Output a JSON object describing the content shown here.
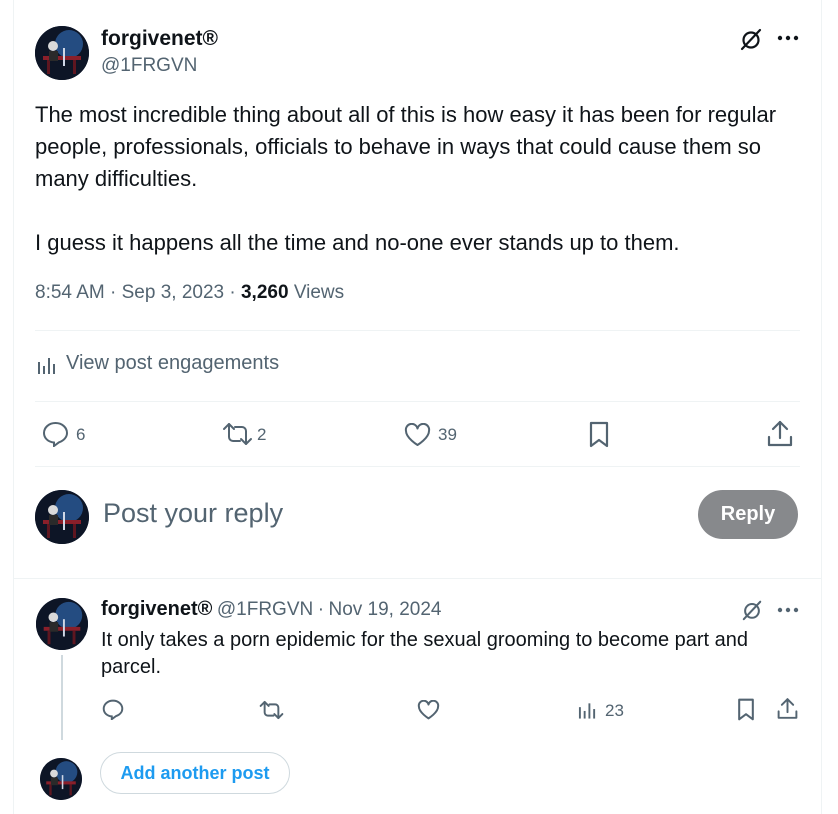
{
  "main_post": {
    "display_name": "forgivenet®",
    "handle": "@1FRGVN",
    "paragraph_1": "The most incredible thing about all of this is how easy it has been for regular people, professionals, officials to behave in ways that could cause them so many difficulties.",
    "paragraph_2": "I guess it happens all the time and no-one ever stands up to them.",
    "time": "8:54 AM",
    "dot": "·",
    "date": "Sep 3, 2023",
    "views_count": "3,260",
    "views_label": "Views",
    "engagements_label": "View post engagements",
    "replies": "6",
    "reposts": "2",
    "likes": "39"
  },
  "composer": {
    "placeholder": "Post your reply",
    "reply_button": "Reply"
  },
  "reply_post": {
    "display_name": "forgivenet®",
    "handle": "@1FRGVN",
    "dot": "·",
    "date": "Nov 19, 2024",
    "text_line_1": "It only takes a porn epidemic for the sexual grooming to become part and",
    "text_line_2": "parcel.",
    "views": "23"
  },
  "add_another": {
    "label": "Add another post"
  },
  "colors": {
    "text": "#0f1419",
    "muted": "#536471",
    "accent": "#1d9bf0",
    "reply_button_bg": "#87898c",
    "border": "#eff3f4"
  }
}
